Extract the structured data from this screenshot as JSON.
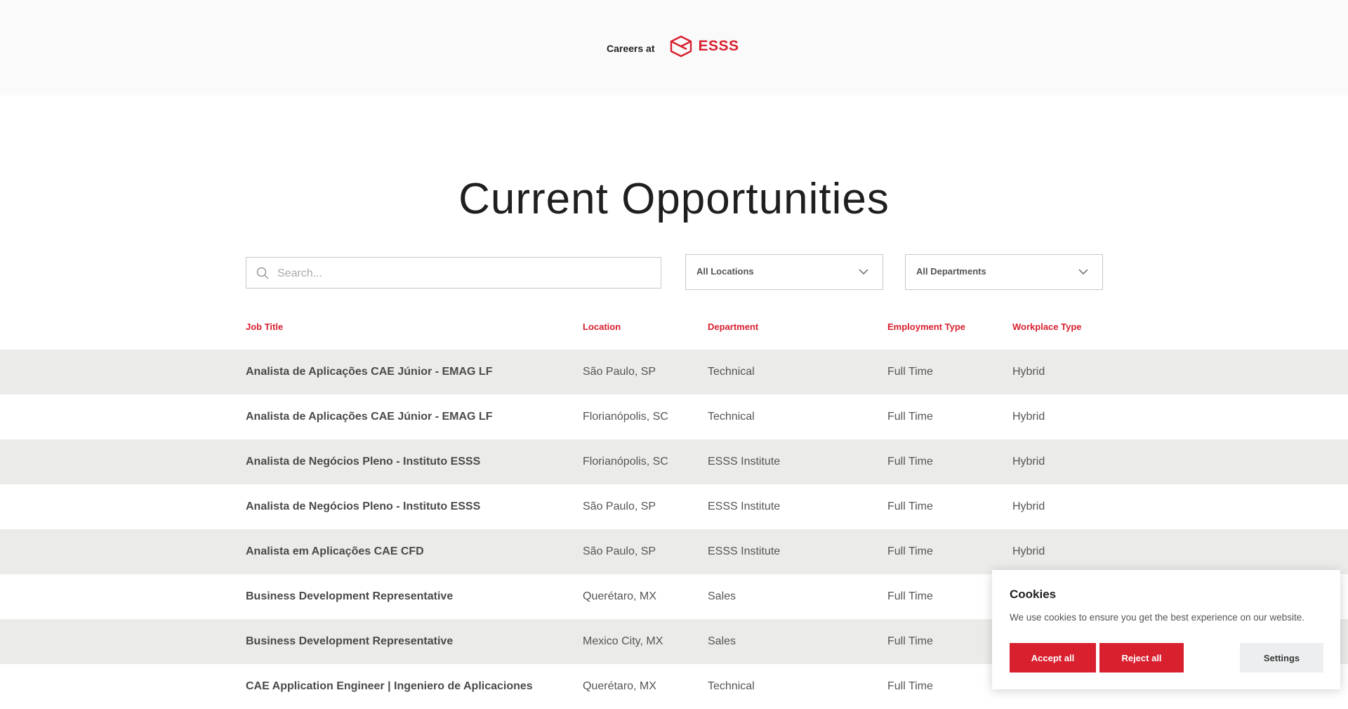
{
  "header": {
    "careers_label": "Careers at",
    "logo_text": "ESSS",
    "brand_color": "#d8202f",
    "logo_icon": "esss-logo-icon"
  },
  "main": {
    "title": "Current Opportunities"
  },
  "filters": {
    "search_placeholder": "Search...",
    "search_value": "",
    "location_selected": "All Locations",
    "department_selected": "All Departments",
    "icons": [
      "search-icon",
      "chevron-down-icon"
    ]
  },
  "table": {
    "columns": [
      "Job Title",
      "Location",
      "Department",
      "Employment Type",
      "Workplace Type"
    ],
    "rows": [
      [
        "Analista de Aplicações CAE Júnior - EMAG LF",
        "São Paulo, SP",
        "Technical",
        "Full Time",
        "Hybrid"
      ],
      [
        "Analista de Aplicações CAE Júnior - EMAG LF",
        "Florianópolis, SC",
        "Technical",
        "Full Time",
        "Hybrid"
      ],
      [
        "Analista de Negócios Pleno - Instituto ESSS",
        "Florianópolis, SC",
        "ESSS Institute",
        "Full Time",
        "Hybrid"
      ],
      [
        "Analista de Negócios Pleno - Instituto ESSS",
        "São Paulo, SP",
        "ESSS Institute",
        "Full Time",
        "Hybrid"
      ],
      [
        "Analista em Aplicações CAE CFD",
        "São Paulo, SP",
        "ESSS Institute",
        "Full Time",
        "Hybrid"
      ],
      [
        "Business Development Representative",
        "Querétaro, MX",
        "Sales",
        "Full Time",
        ""
      ],
      [
        "Business Development Representative",
        "Mexico City, MX",
        "Sales",
        "Full Time",
        ""
      ],
      [
        "CAE Application Engineer | Ingeniero de Aplicaciones",
        "Querétaro, MX",
        "Technical",
        "Full Time",
        ""
      ]
    ],
    "row_alt_color": "#ebebe9"
  },
  "cookie": {
    "title": "Cookies",
    "text": "We use cookies to ensure you get the best experience on our website.",
    "accept_label": "Accept all",
    "reject_label": "Reject all",
    "settings_label": "Settings"
  }
}
